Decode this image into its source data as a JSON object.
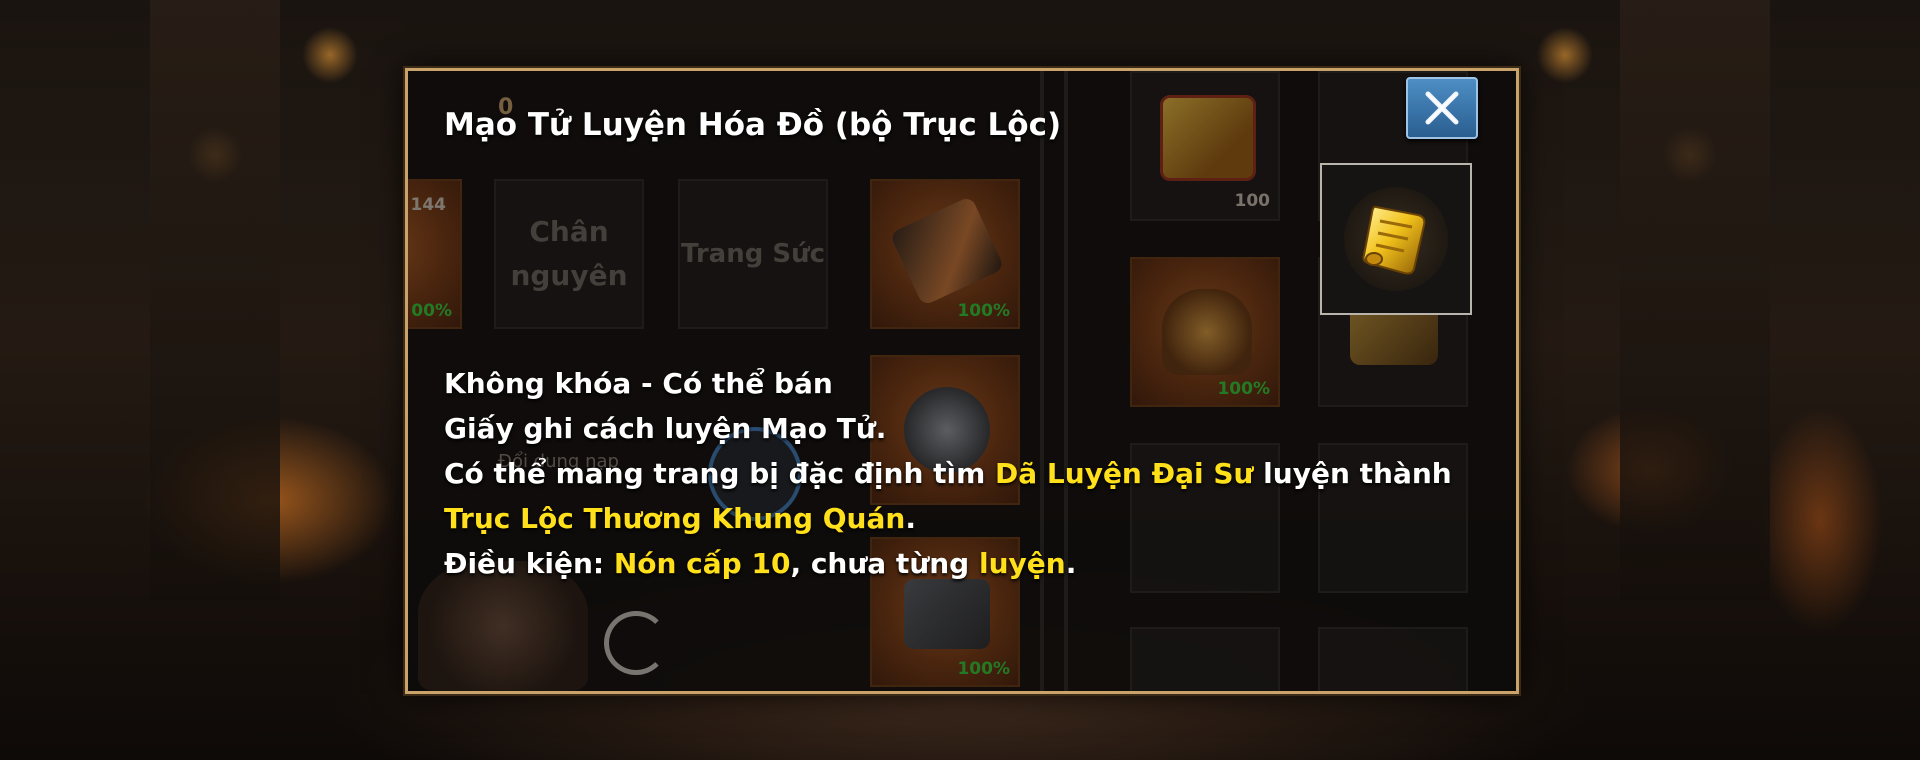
{
  "dialog": {
    "title": "Mạo Tử Luyện Hóa Đồ (bộ Trục Lộc)",
    "close_icon": "close-x-icon",
    "selected_item_icon": "golden-scroll-icon",
    "description": {
      "line1": "Không khóa - Có thể bán",
      "line2": "Giấy ghi cách luyện Mạo Tử.",
      "line3_part1": "Có thể mang trang bị đặc định tìm ",
      "line3_npc": "Dã Luyện Đại Sư",
      "line3_part2": " luyện thành ",
      "line3_item": "Trục Lộc Thương Khung Quán",
      "line3_end": ".",
      "line4_label": "Điều kiện: ",
      "line4_req": "Nón cấp 10",
      "line4_mid": ", chưa từng ",
      "line4_req2": "luyện",
      "line4_end": "."
    }
  },
  "background_inventory": {
    "partial_top_count": "0",
    "slot_edge_count": "144",
    "slot_edge_pct": "00%",
    "slot_chan_nguyen_line1": "Chân",
    "slot_chan_nguyen_line2": "nguyên",
    "slot_trang_suc": "Trang Sức",
    "slot_weapon_pct": "100%",
    "slot_bottom_pct": "100%",
    "right_top_count": "100",
    "right_helmet_pct": "100%",
    "faint_button_text": "Đổi dung nạp",
    "colors": {
      "percent_green": "#35d43a",
      "highlight_yellow": "#ffe01a",
      "frame_gold": "#c9a36a",
      "close_blue": "#3a78b0"
    }
  }
}
